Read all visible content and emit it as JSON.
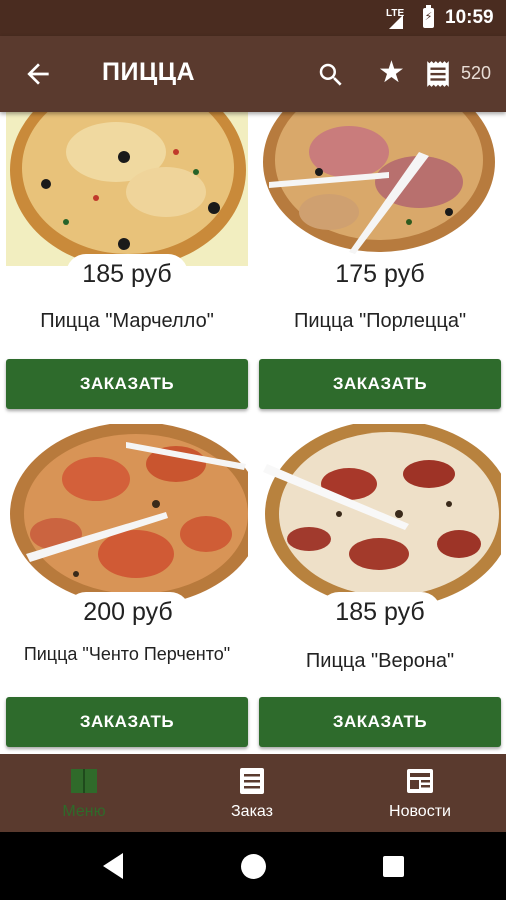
{
  "status_bar": {
    "network": "LTE",
    "time": "10:59"
  },
  "toolbar": {
    "title": "ПИЦЦА",
    "back_icon": "arrow-back-icon",
    "search_icon": "search-icon",
    "favorites_icon": "star-icon",
    "receipt_icon": "receipt-icon",
    "receipt_count": "520"
  },
  "products": [
    {
      "price": "185 руб",
      "name": "Пицца \"Марчелло\"",
      "order_label": "ЗАКАЗАТЬ"
    },
    {
      "price": "175 руб",
      "name": "Пицца \"Порлецца\"",
      "order_label": "ЗАКАЗАТЬ"
    },
    {
      "price": "200 руб",
      "name": "Пицца \"Ченто Перченто\"",
      "order_label": "ЗАКАЗАТЬ"
    },
    {
      "price": "185 руб",
      "name": "Пицца \"Верона\"",
      "order_label": "ЗАКАЗАТЬ"
    }
  ],
  "bottom_nav": [
    {
      "label": "Меню",
      "icon": "menu-book-icon",
      "active": true
    },
    {
      "label": "Заказ",
      "icon": "order-list-icon",
      "active": false
    },
    {
      "label": "Новости",
      "icon": "news-icon",
      "active": false
    }
  ],
  "colors": {
    "toolbar": "#5a3a2e",
    "status_bar": "#4a2c20",
    "order_button": "#2e6b2c",
    "active_nav": "#2f6a2a"
  }
}
